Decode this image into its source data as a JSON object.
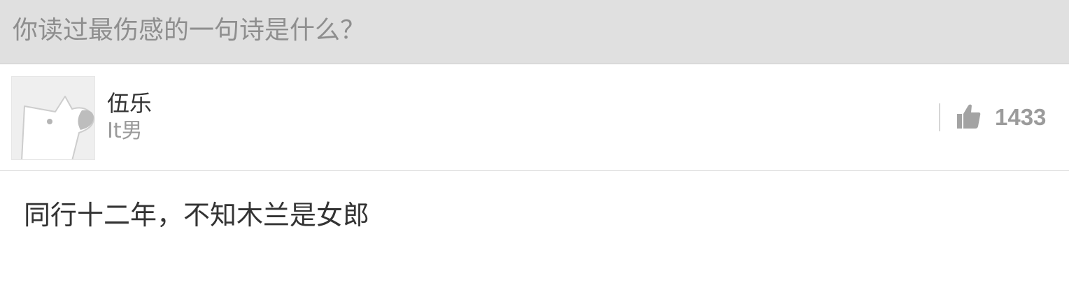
{
  "question": {
    "title": "你读过最伤感的一句诗是什么？"
  },
  "author": {
    "name": "伍乐",
    "bio": "It男",
    "avatar_icon": "default-dog-avatar-icon"
  },
  "vote": {
    "icon": "thumbs-up-icon",
    "count": "1433"
  },
  "answer": {
    "text": "同行十二年，不知木兰是女郎"
  },
  "colors": {
    "header_bg": "#e0e0e0",
    "muted_text": "#9b9b9b",
    "body_text": "#333333"
  }
}
